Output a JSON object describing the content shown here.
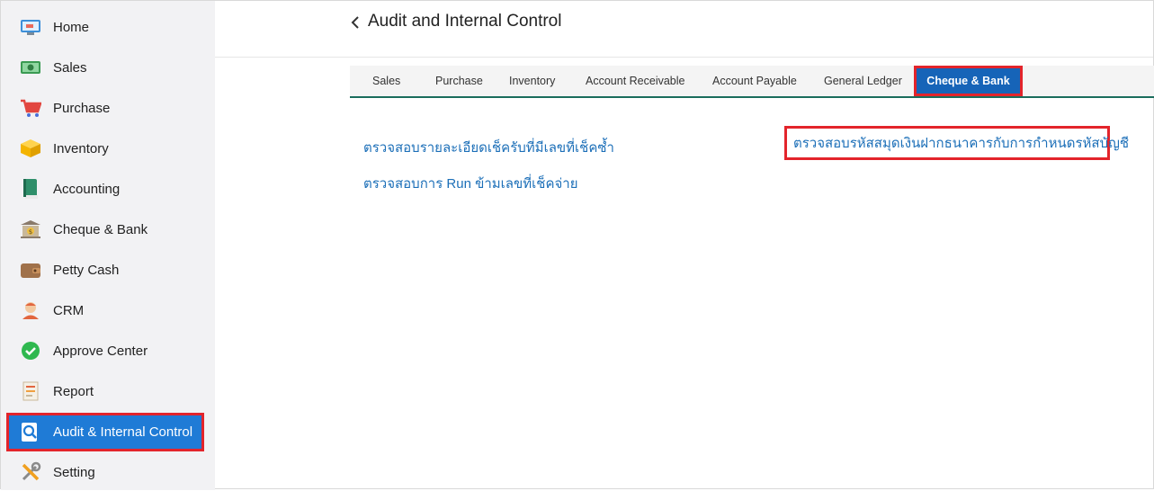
{
  "sidebar": {
    "items": [
      {
        "label": "Home",
        "icon": "home-icon"
      },
      {
        "label": "Sales",
        "icon": "money-icon"
      },
      {
        "label": "Purchase",
        "icon": "cart-icon"
      },
      {
        "label": "Inventory",
        "icon": "box-icon"
      },
      {
        "label": "Accounting",
        "icon": "book-icon"
      },
      {
        "label": "Cheque & Bank",
        "icon": "bank-icon"
      },
      {
        "label": "Petty Cash",
        "icon": "wallet-icon"
      },
      {
        "label": "CRM",
        "icon": "customer-icon"
      },
      {
        "label": "Approve Center",
        "icon": "check-circle-icon"
      },
      {
        "label": "Report",
        "icon": "report-icon"
      },
      {
        "label": "Audit & Internal Control",
        "icon": "audit-search-icon",
        "active": true
      },
      {
        "label": "Setting",
        "icon": "tools-icon"
      }
    ]
  },
  "header": {
    "title": "Audit and Internal Control"
  },
  "tabs": [
    {
      "label": "Sales"
    },
    {
      "label": "Purchase"
    },
    {
      "label": "Inventory"
    },
    {
      "label": "Account Receivable"
    },
    {
      "label": "Account Payable"
    },
    {
      "label": "General Ledger"
    },
    {
      "label": "Cheque & Bank",
      "active": true
    }
  ],
  "links": {
    "check_received_duplicate": "ตรวจสอบรายละเอียดเช็ครับที่มีเลขที่เช็คซ้ำ",
    "check_run_skip": "ตรวจสอบการ Run ข้ามเลขที่เช็คจ่าย",
    "check_bank_account_code": "ตรวจสอบรหัสสมุดเงินฝากธนาคารกับการกำหนดรหัสบัญชี"
  },
  "colors": {
    "accent": "#1f7bd6",
    "highlight_border": "#e3242b",
    "link": "#1c6fb8",
    "tab_underline": "#1a6d5c"
  }
}
